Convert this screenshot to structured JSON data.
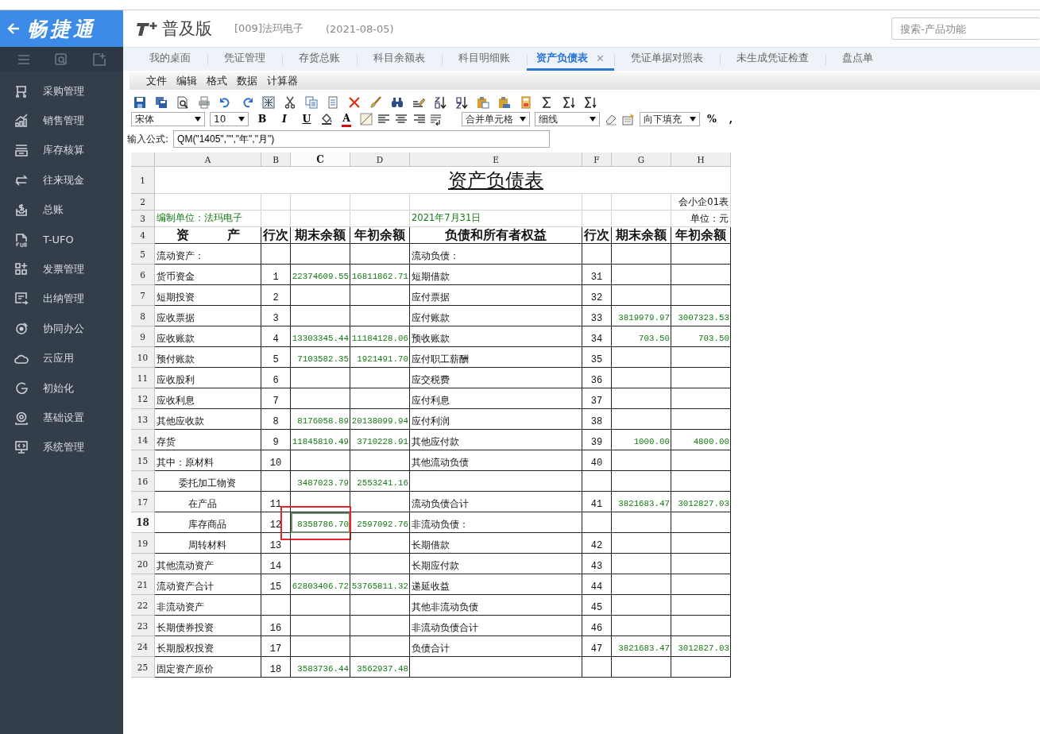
{
  "sidebar": {
    "logo": "畅捷通",
    "items": [
      {
        "label": "采购管理"
      },
      {
        "label": "销售管理"
      },
      {
        "label": "库存核算"
      },
      {
        "label": "往来现金"
      },
      {
        "label": "总账"
      },
      {
        "label": "T-UFO"
      },
      {
        "label": "发票管理"
      },
      {
        "label": "出纳管理"
      },
      {
        "label": "协同办公"
      },
      {
        "label": "云应用"
      },
      {
        "label": "初始化"
      },
      {
        "label": "基础设置"
      },
      {
        "label": "系统管理"
      }
    ]
  },
  "header": {
    "product": "普及版",
    "company": "[009]法玛电子",
    "date": "(2021-08-05)",
    "search": {
      "placeholder": "搜索-产品功能"
    }
  },
  "tabs": [
    {
      "label": "我的桌面",
      "selected": false
    },
    {
      "label": "凭证管理",
      "selected": false
    },
    {
      "label": "存货总账",
      "selected": false
    },
    {
      "label": "科目余额表",
      "selected": false
    },
    {
      "label": "科目明细账",
      "selected": false
    },
    {
      "label": "资产负债表",
      "selected": true,
      "close": "✕"
    },
    {
      "label": "凭证单据对照表",
      "selected": false
    },
    {
      "label": "未生成凭证检查",
      "selected": false
    },
    {
      "label": "盘点单",
      "selected": false
    }
  ],
  "menu": [
    "文件",
    "编辑",
    "格式",
    "数据",
    "计算器"
  ],
  "format_bar": {
    "font": "宋体",
    "size": "10",
    "bold": "B",
    "italic": "I",
    "underline": "U",
    "font_color": "A",
    "merge": "合并单元格",
    "border": "细线",
    "fill": "向下填充",
    "percent": "%",
    "comma": ","
  },
  "formula": {
    "label": "输入公式:",
    "value": "QM(\"1405\",\"\",\"年\",\"月\")"
  },
  "sheet": {
    "columns": [
      "A",
      "B",
      "C",
      "D",
      "E",
      "F",
      "G",
      "H"
    ],
    "rows": [
      {
        "number": "1",
        "kind": "title",
        "cells": [
          {
            "selected": false
          },
          {
            "selected": false
          },
          {
            "selected": false
          },
          {
            "selected": false
          },
          {
            "text": "资产负债表",
            "selected": false
          },
          {
            "selected": false
          },
          {
            "selected": false
          },
          {
            "selected": false
          }
        ]
      },
      {
        "number": "2",
        "kind": "plain",
        "cells": [
          {
            "selected": false
          },
          {
            "selected": false
          },
          {
            "selected": false
          },
          {
            "selected": false
          },
          {
            "selected": false
          },
          {
            "selected": false
          },
          {
            "selected": false
          },
          {
            "text": "会小企01表",
            "selected": false
          }
        ]
      },
      {
        "number": "3",
        "kind": "caption",
        "cells": [
          {
            "text": "编制单位：法玛电子",
            "selected": false
          },
          {
            "selected": false
          },
          {
            "selected": false
          },
          {
            "selected": false
          },
          {
            "text": "2021年7月31日",
            "selected": false
          },
          {
            "selected": false
          },
          {
            "selected": false
          },
          {
            "text": "单位：元",
            "selected": false
          }
        ]
      },
      {
        "number": "4",
        "kind": "head",
        "cells": [
          {
            "text": "资　　　产",
            "selected": false
          },
          {
            "text": "行次",
            "selected": false
          },
          {
            "text": "期末余额",
            "selected": false
          },
          {
            "text": "年初余额",
            "selected": false
          },
          {
            "text": "负债和所有者权益",
            "selected": false
          },
          {
            "text": "行次",
            "selected": false
          },
          {
            "text": "期末余额",
            "selected": false
          },
          {
            "text": "年初余额",
            "selected": false
          }
        ]
      },
      {
        "number": "5",
        "kind": "body",
        "cells": [
          {
            "text": "流动资产：",
            "selected": false
          },
          {
            "selected": false
          },
          {
            "selected": false
          },
          {
            "selected": false
          },
          {
            "text": "流动负债：",
            "selected": false
          },
          {
            "selected": false
          },
          {
            "selected": false
          },
          {
            "selected": false
          }
        ]
      },
      {
        "number": "6",
        "kind": "body",
        "cells": [
          {
            "text": "货币资金",
            "selected": false
          },
          {
            "text": "1",
            "selected": false
          },
          {
            "text": "22374609.55",
            "selected": false
          },
          {
            "text": "16811862.71",
            "selected": false
          },
          {
            "text": "短期借款",
            "selected": false
          },
          {
            "text": "31",
            "selected": false
          },
          {
            "selected": false
          },
          {
            "selected": false
          }
        ]
      },
      {
        "number": "7",
        "kind": "body",
        "cells": [
          {
            "text": "短期投资",
            "selected": false
          },
          {
            "text": "2",
            "selected": false
          },
          {
            "selected": false
          },
          {
            "selected": false
          },
          {
            "text": "应付票据",
            "selected": false
          },
          {
            "text": "32",
            "selected": false
          },
          {
            "selected": false
          },
          {
            "selected": false
          }
        ]
      },
      {
        "number": "8",
        "kind": "body",
        "cells": [
          {
            "text": "应收票据",
            "selected": false
          },
          {
            "text": "3",
            "selected": false
          },
          {
            "selected": false
          },
          {
            "selected": false
          },
          {
            "text": "应付账款",
            "selected": false
          },
          {
            "text": "33",
            "selected": false
          },
          {
            "text": "3819979.97",
            "selected": false
          },
          {
            "text": "3007323.53",
            "selected": false
          }
        ]
      },
      {
        "number": "9",
        "kind": "body",
        "cells": [
          {
            "text": "应收账款",
            "selected": false
          },
          {
            "text": "4",
            "selected": false
          },
          {
            "text": "13303345.44",
            "selected": false
          },
          {
            "text": "11184128.06",
            "selected": false
          },
          {
            "text": "预收账款",
            "selected": false
          },
          {
            "text": "34",
            "selected": false
          },
          {
            "text": "703.50",
            "selected": false
          },
          {
            "text": "703.50",
            "selected": false
          }
        ]
      },
      {
        "number": "10",
        "kind": "body",
        "cells": [
          {
            "text": "预付账款",
            "selected": false
          },
          {
            "text": "5",
            "selected": false
          },
          {
            "text": "7103582.35",
            "selected": false
          },
          {
            "text": "1921491.70",
            "selected": false
          },
          {
            "text": "应付职工薪酬",
            "selected": false
          },
          {
            "text": "35",
            "selected": false
          },
          {
            "selected": false
          },
          {
            "selected": false
          }
        ]
      },
      {
        "number": "11",
        "kind": "body",
        "cells": [
          {
            "text": "应收股利",
            "selected": false
          },
          {
            "text": "6",
            "selected": false
          },
          {
            "selected": false
          },
          {
            "selected": false
          },
          {
            "text": "应交税费",
            "selected": false
          },
          {
            "text": "36",
            "selected": false
          },
          {
            "selected": false
          },
          {
            "selected": false
          }
        ]
      },
      {
        "number": "12",
        "kind": "body",
        "cells": [
          {
            "text": "应收利息",
            "selected": false
          },
          {
            "text": "7",
            "selected": false
          },
          {
            "selected": false
          },
          {
            "selected": false
          },
          {
            "text": "应付利息",
            "selected": false
          },
          {
            "text": "37",
            "selected": false
          },
          {
            "selected": false
          },
          {
            "selected": false
          }
        ]
      },
      {
        "number": "13",
        "kind": "body",
        "cells": [
          {
            "text": "其他应收款",
            "selected": false
          },
          {
            "text": "8",
            "selected": false
          },
          {
            "text": "8176058.89",
            "selected": false
          },
          {
            "text": "20138099.94",
            "selected": false
          },
          {
            "text": "应付利润",
            "selected": false
          },
          {
            "text": "38",
            "selected": false
          },
          {
            "selected": false
          },
          {
            "selected": false
          }
        ]
      },
      {
        "number": "14",
        "kind": "body",
        "cells": [
          {
            "text": "存货",
            "selected": false
          },
          {
            "text": "9",
            "selected": false
          },
          {
            "text": "11845810.49",
            "selected": false
          },
          {
            "text": "3710228.91",
            "selected": false
          },
          {
            "text": "其他应付款",
            "selected": false
          },
          {
            "text": "39",
            "selected": false
          },
          {
            "text": "1000.00",
            "selected": false
          },
          {
            "text": "4800.00",
            "selected": false
          }
        ]
      },
      {
        "number": "15",
        "kind": "body",
        "cells": [
          {
            "text": "其中：原材料",
            "selected": false
          },
          {
            "text": "10",
            "selected": false
          },
          {
            "selected": false
          },
          {
            "selected": false
          },
          {
            "text": "其他流动负债",
            "selected": false
          },
          {
            "text": "40",
            "selected": false
          },
          {
            "selected": false
          },
          {
            "selected": false
          }
        ]
      },
      {
        "number": "16",
        "kind": "body",
        "cells": [
          {
            "text": "委托加工物资",
            "kind": "sub",
            "selected": false
          },
          {
            "selected": false
          },
          {
            "text": "3487023.79",
            "selected": false
          },
          {
            "text": "2553241.16",
            "selected": false
          },
          {
            "selected": false
          },
          {
            "selected": false
          },
          {
            "selected": false
          },
          {
            "selected": false
          }
        ]
      },
      {
        "number": "17",
        "kind": "body",
        "cells": [
          {
            "text": "在产品",
            "kind": "sub2",
            "selected": false
          },
          {
            "text": "11",
            "selected": false
          },
          {
            "selected": false
          },
          {
            "selected": false
          },
          {
            "text": "流动负债合计",
            "selected": false
          },
          {
            "text": "41",
            "selected": false
          },
          {
            "text": "3821683.47",
            "selected": false
          },
          {
            "text": "3012827.03",
            "selected": false
          }
        ]
      },
      {
        "number": "18",
        "kind": "body",
        "cells": [
          {
            "text": "库存商品",
            "kind": "sub2",
            "selected": false
          },
          {
            "text": "12",
            "selected": false
          },
          {
            "text": "8358786.70",
            "selected": true
          },
          {
            "text": "2597092.76",
            "selected": false
          },
          {
            "text": "非流动负债：",
            "selected": false
          },
          {
            "selected": false
          },
          {
            "selected": false
          },
          {
            "selected": false
          }
        ]
      },
      {
        "number": "19",
        "kind": "body",
        "cells": [
          {
            "text": "周转材料",
            "kind": "sub2",
            "selected": false
          },
          {
            "text": "13",
            "selected": false
          },
          {
            "selected": false
          },
          {
            "selected": false
          },
          {
            "text": "长期借款",
            "selected": false
          },
          {
            "text": "42",
            "selected": false
          },
          {
            "selected": false
          },
          {
            "selected": false
          }
        ]
      },
      {
        "number": "20",
        "kind": "body",
        "cells": [
          {
            "text": "其他流动资产",
            "selected": false
          },
          {
            "text": "14",
            "selected": false
          },
          {
            "selected": false
          },
          {
            "selected": false
          },
          {
            "text": "长期应付款",
            "selected": false
          },
          {
            "text": "43",
            "selected": false
          },
          {
            "selected": false
          },
          {
            "selected": false
          }
        ]
      },
      {
        "number": "21",
        "kind": "body",
        "cells": [
          {
            "text": "流动资产合计",
            "selected": false
          },
          {
            "text": "15",
            "selected": false
          },
          {
            "text": "62803406.72",
            "selected": false
          },
          {
            "text": "53765811.32",
            "selected": false
          },
          {
            "text": "递延收益",
            "selected": false
          },
          {
            "text": "44",
            "selected": false
          },
          {
            "selected": false
          },
          {
            "selected": false
          }
        ]
      },
      {
        "number": "22",
        "kind": "body",
        "cells": [
          {
            "text": "非流动资产",
            "selected": false
          },
          {
            "selected": false
          },
          {
            "selected": false
          },
          {
            "selected": false
          },
          {
            "text": "其他非流动负债",
            "selected": false
          },
          {
            "text": "45",
            "selected": false
          },
          {
            "selected": false
          },
          {
            "selected": false
          }
        ]
      },
      {
        "number": "23",
        "kind": "body",
        "cells": [
          {
            "text": "长期债券投资",
            "selected": false
          },
          {
            "text": "16",
            "selected": false
          },
          {
            "selected": false
          },
          {
            "selected": false
          },
          {
            "text": "非流动负债合计",
            "selected": false
          },
          {
            "text": "46",
            "selected": false
          },
          {
            "selected": false
          },
          {
            "selected": false
          }
        ]
      },
      {
        "number": "24",
        "kind": "body",
        "cells": [
          {
            "text": "长期股权投资",
            "selected": false
          },
          {
            "text": "17",
            "selected": false
          },
          {
            "selected": false
          },
          {
            "selected": false
          },
          {
            "text": "负债合计",
            "selected": false
          },
          {
            "text": "47",
            "selected": false
          },
          {
            "text": "3821683.47",
            "selected": false
          },
          {
            "text": "3012827.03",
            "selected": false
          }
        ]
      },
      {
        "number": "25",
        "kind": "body",
        "cells": [
          {
            "text": "固定资产原价",
            "selected": false
          },
          {
            "text": "18",
            "selected": false
          },
          {
            "text": "3583736.44",
            "selected": false
          },
          {
            "text": "3562937.48",
            "selected": false
          },
          {
            "selected": false
          },
          {
            "selected": false
          },
          {
            "selected": false
          },
          {
            "selected": false
          }
        ]
      }
    ]
  }
}
